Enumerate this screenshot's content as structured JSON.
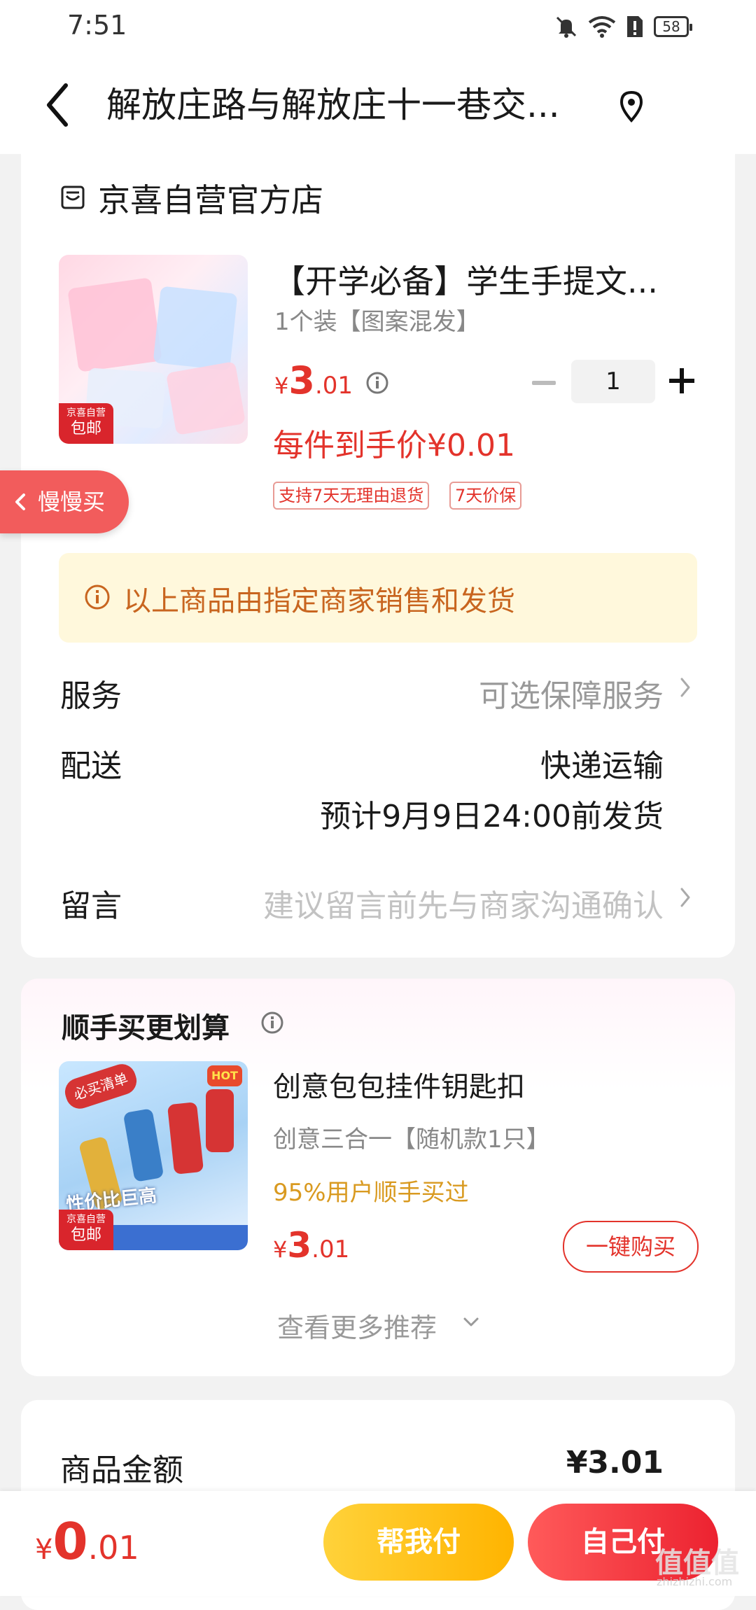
{
  "status_bar": {
    "time": "7:51",
    "battery": "58"
  },
  "header": {
    "title": "解放庄路与解放庄十一巷交..."
  },
  "store": {
    "name": "京喜自营官方店"
  },
  "product": {
    "title": "【开学必备】学生手提文...",
    "spec": "1个装【图案混发】",
    "price_symbol": "¥",
    "price_int": "3",
    "price_dec": ".01",
    "quantity": "1",
    "final_price": "每件到手价¥0.01",
    "tags": [
      "支持7天无理由退货",
      "7天价保"
    ],
    "badge_line1": "京喜自营",
    "badge_line2": "包邮"
  },
  "slow_buy": {
    "label": "慢慢买"
  },
  "notice": {
    "text": "以上商品由指定商家销售和发货"
  },
  "service": {
    "label": "服务",
    "value": "可选保障服务"
  },
  "delivery": {
    "label": "配送",
    "method": "快递运输",
    "estimate": "预计9月9日24:00前发货"
  },
  "message": {
    "label": "留言",
    "placeholder": "建议留言前先与商家沟通确认"
  },
  "recommend": {
    "title": "顺手买更划算",
    "item": {
      "name": "创意包包挂件钥匙扣",
      "spec": "创意三合一【随机款1只】",
      "social": "95%用户顺手买过",
      "price_symbol": "¥",
      "price_int": "3",
      "price_dec": ".01",
      "button": "一键购买",
      "image_stamp": "必买清单",
      "image_hot": "HOT",
      "image_slogan": "性价比巨高",
      "badge_line1": "京喜自营",
      "badge_line2": "包邮"
    },
    "see_more": "查看更多推荐"
  },
  "summary": {
    "goods_amount_label": "商品金额",
    "goods_amount_value": "¥3.01"
  },
  "bottom_bar": {
    "total_symbol": "¥",
    "total_int": "0",
    "total_dec": ".01",
    "help_pay": "帮我付",
    "self_pay": "自己付"
  },
  "watermark": {
    "title": "值值值",
    "sub": "zhizhizhi.com"
  },
  "colors": {
    "accent_red": "#e3332b",
    "notice_bg": "#fff8dc",
    "notice_text": "#c8651f",
    "help_pay_yellow": "#ffc21a",
    "self_pay_red": "#f0303a"
  }
}
